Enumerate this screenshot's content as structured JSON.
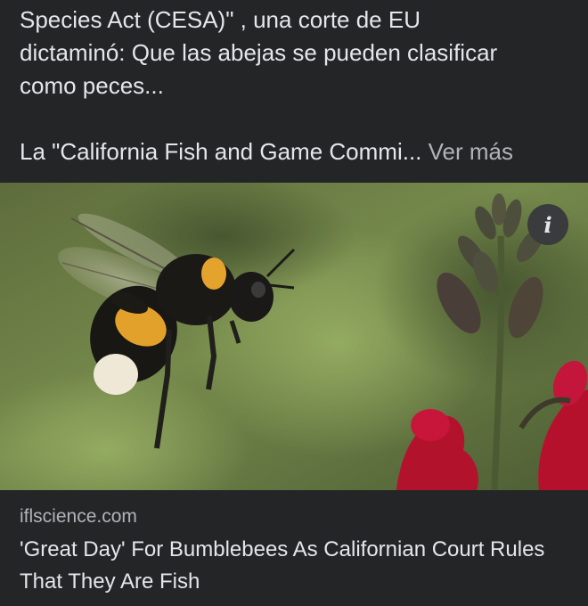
{
  "post": {
    "line1": "Species Act (CESA)\" , una  corte de EU",
    "line2": "dictaminó:  Que las abejas se pueden clasificar",
    "line3": "como peces...",
    "line4": "La \"California Fish and Game Commi...",
    "see_more": "Ver más"
  },
  "photo": {
    "info_icon": "info-icon",
    "info_glyph": "i"
  },
  "link": {
    "domain": "iflscience.com",
    "title": "'Great Day' For Bumblebees As Californian Court Rules That They Are Fish"
  },
  "colors": {
    "background": "#242526",
    "text": "#e4e6eb",
    "secondary": "#b0b3b8"
  }
}
